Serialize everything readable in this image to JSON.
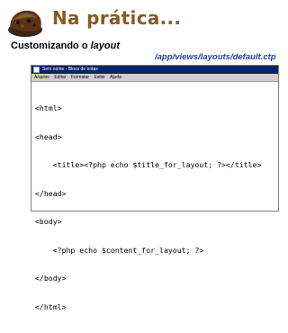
{
  "header": {
    "title": "Na prática...",
    "subtitle_prefix": "Customizando o ",
    "subtitle_emph": "layout",
    "file_path": "/app/views/layouts/default.ctp",
    "title_color": "#8a5a22",
    "path_color": "#1f3fa8"
  },
  "window": {
    "title": "Sem nome - Bloco de notas",
    "menu": [
      "Arquivo",
      "Editar",
      "Formatar",
      "Exibir",
      "Ajuda"
    ],
    "titlebar_color": "#0a246a"
  },
  "code": {
    "lines": [
      "<html>",
      "<head>",
      "    <title><?php echo $title_for_layout; ?></title>",
      "</head>",
      "<body>",
      "    <?php echo $content_for_layout; ?>",
      "</body>",
      "</html>"
    ]
  }
}
